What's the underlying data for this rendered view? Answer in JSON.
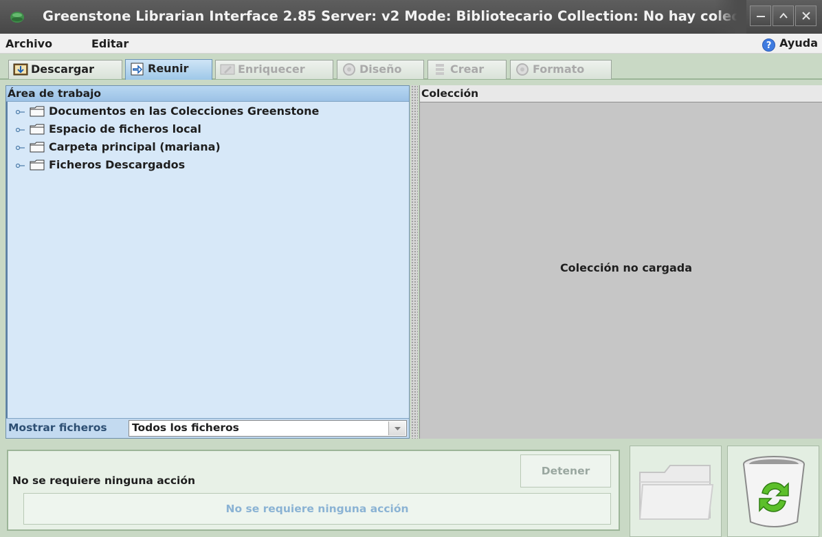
{
  "window": {
    "title": "Greenstone Librarian Interface 2.85  Server: v2  Mode: Bibliotecario  Collection: No hay colección cargada",
    "colors": {
      "titlebar": "#4f4f4f",
      "accent": "#9ec8e8",
      "background": "#c9d9c5"
    }
  },
  "menu": {
    "file": "Archivo",
    "edit": "Editar",
    "help": "Ayuda"
  },
  "tabs": [
    {
      "label": "Descargar",
      "icon": "download-icon",
      "state": "enabled"
    },
    {
      "label": "Reunir",
      "icon": "gather-icon",
      "state": "active"
    },
    {
      "label": "Enriquecer",
      "icon": "enrich-icon",
      "state": "disabled"
    },
    {
      "label": "Diseño",
      "icon": "design-icon",
      "state": "disabled"
    },
    {
      "label": "Crear",
      "icon": "create-icon",
      "state": "disabled"
    },
    {
      "label": "Formato",
      "icon": "format-icon",
      "state": "disabled"
    }
  ],
  "workspace": {
    "header": "Área de trabajo",
    "items": [
      "Documentos en las Colecciones Greenstone",
      "Espacio de ficheros local",
      "Carpeta principal (mariana)",
      "Ficheros Descargados"
    ],
    "filter_label": "Mostrar ficheros",
    "filter_value": "Todos los ficheros"
  },
  "collection": {
    "header": "Colección",
    "empty_message": "Colección no cargada"
  },
  "status": {
    "message": "No se requiere ninguna acción",
    "stop_label": "Detener",
    "progress_text": "No se requiere ninguna acción"
  }
}
